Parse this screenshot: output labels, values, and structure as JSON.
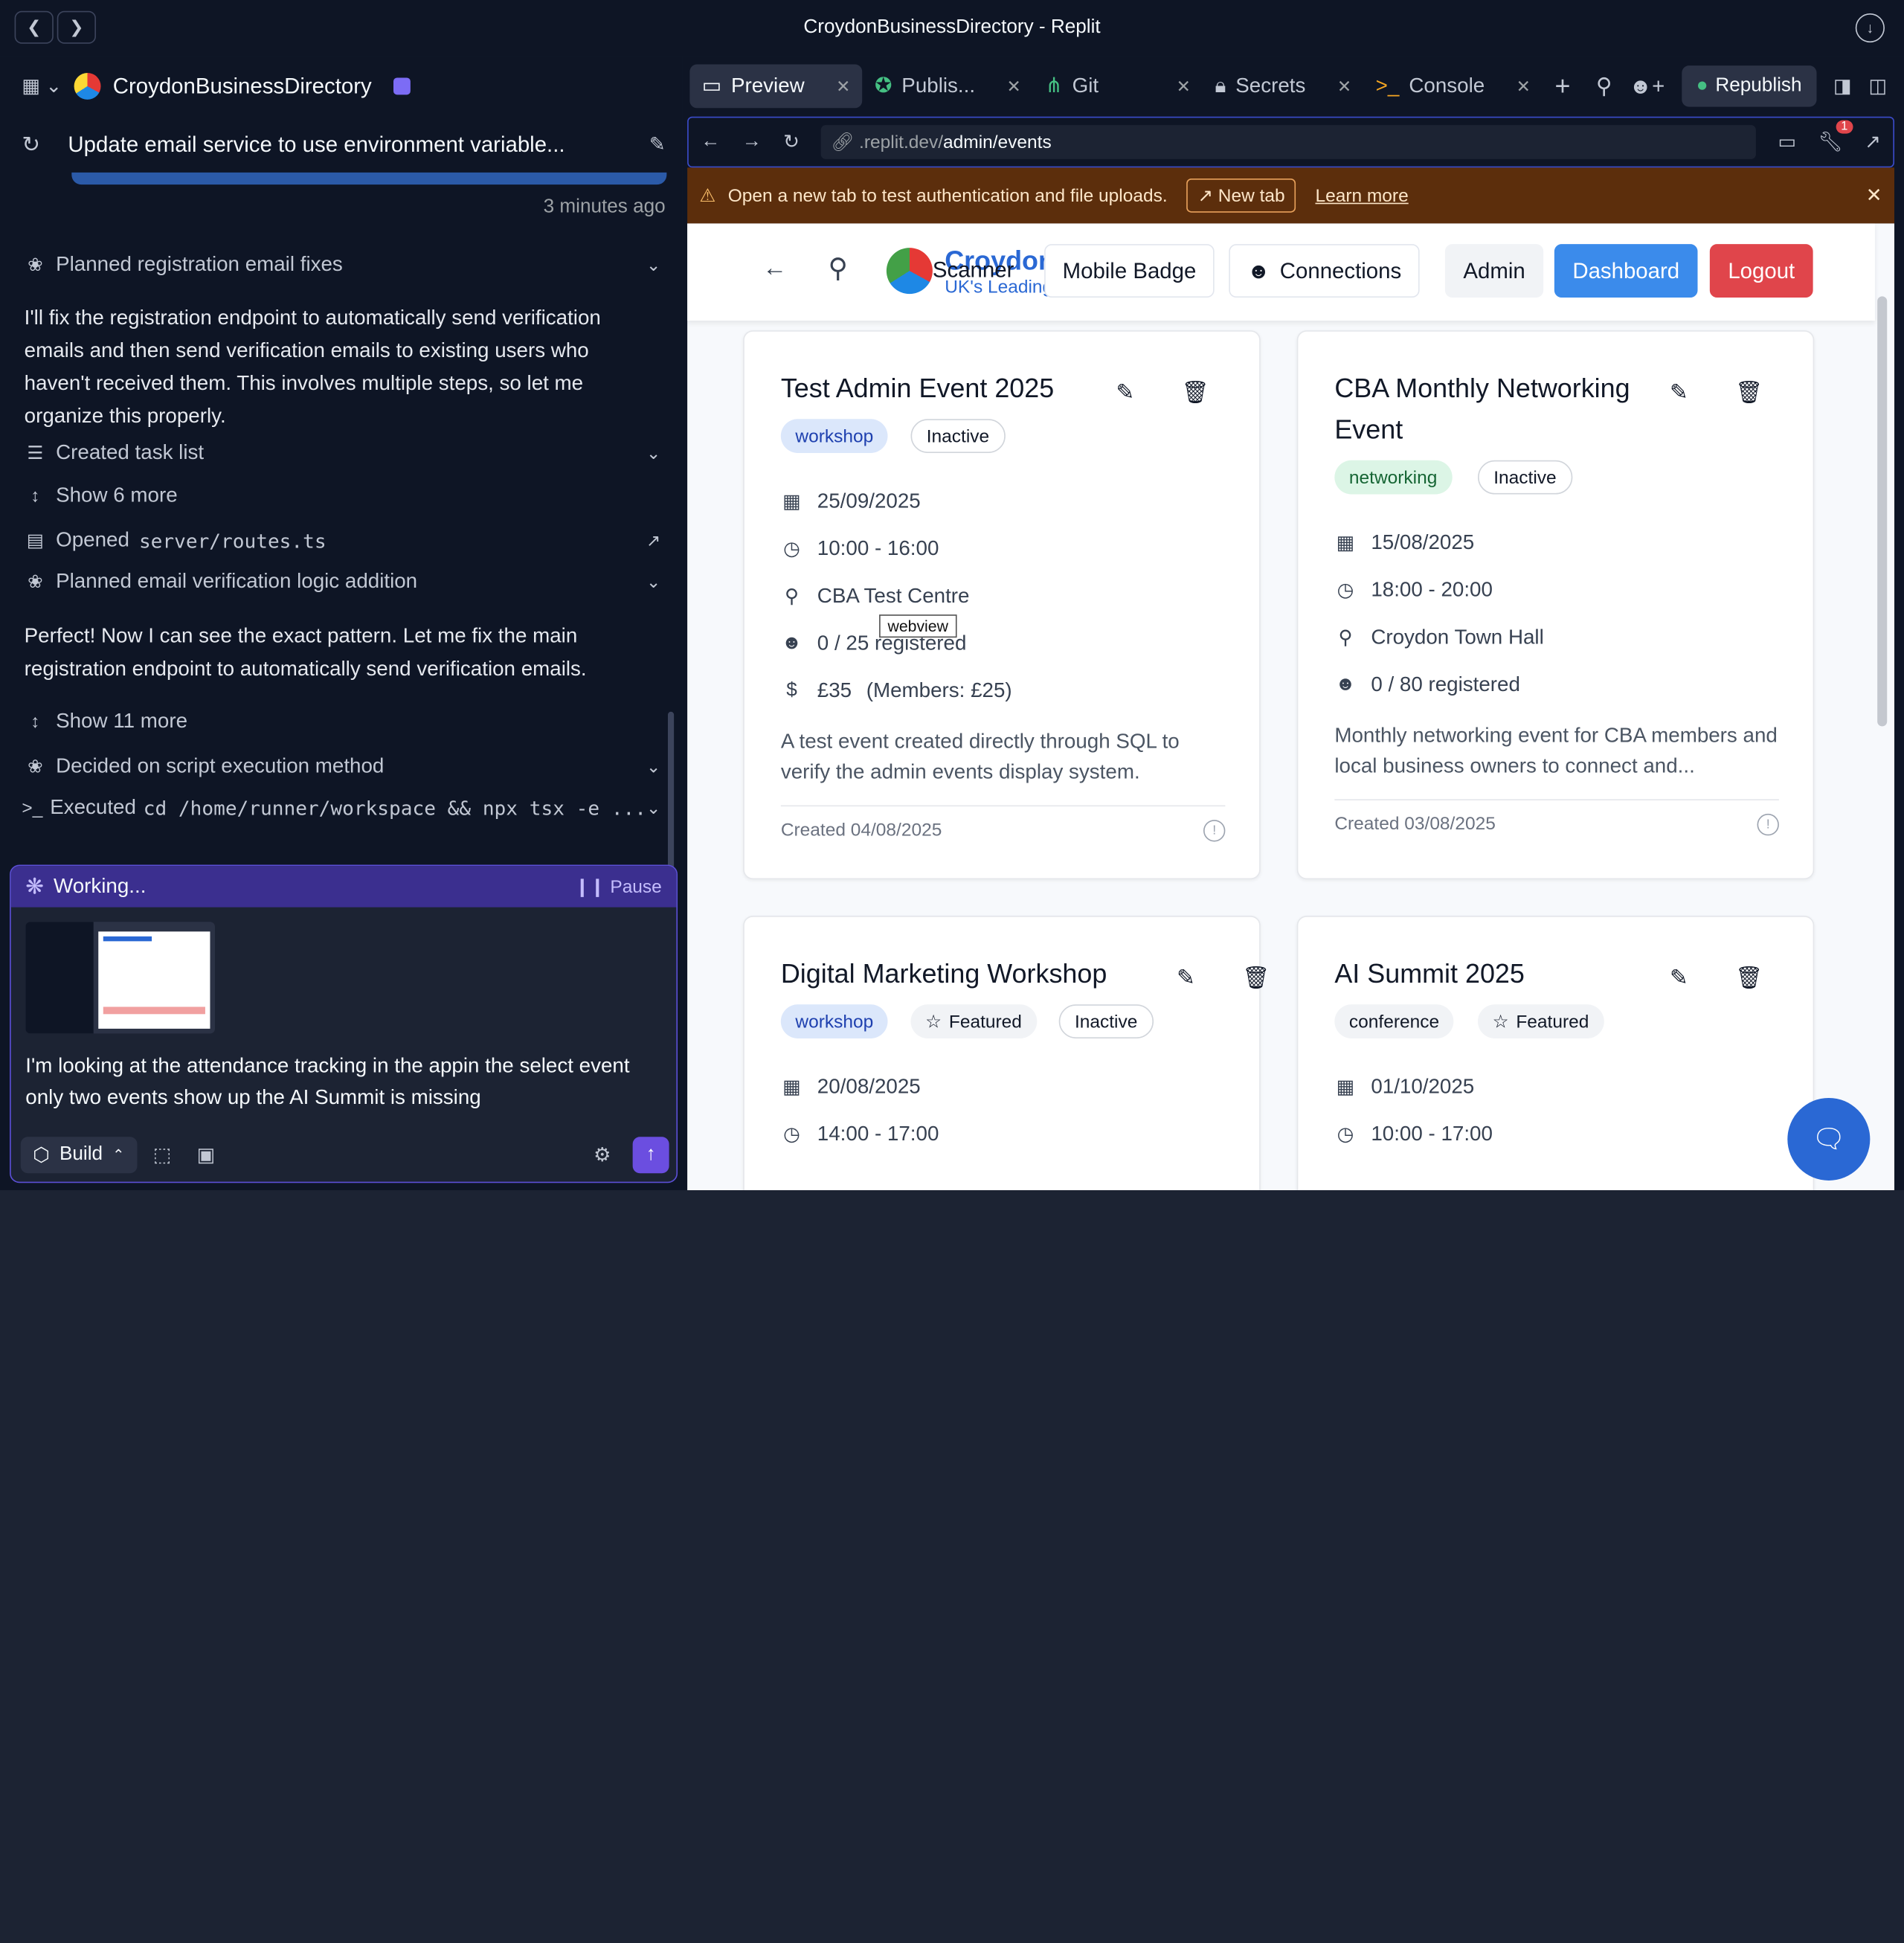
{
  "window": {
    "title": "CroydonBusinessDirectory - Replit"
  },
  "project": {
    "name": "CroydonBusinessDirectory"
  },
  "thread": {
    "title": "Update email service to use environment variable...",
    "time": "3 minutes ago"
  },
  "feed": {
    "step1": "Planned registration email fixes",
    "para1": "I'll fix the registration endpoint to automatically send verification emails and then send verification emails to existing users who haven't received them. This involves multiple steps, so let me organize this properly.",
    "step2": "Created task list",
    "more1": "Show 6 more",
    "opened_prefix": "Opened",
    "opened_file": "server/routes.ts",
    "step3": "Planned email verification logic addition",
    "para2": "Perfect! Now I can see the exact pattern. Let me fix the main registration endpoint to automatically send verification emails.",
    "more2": "Show 11 more",
    "step4": "Decided on script execution method",
    "exec_prefix": "Executed",
    "exec_cmd": "cd /home/runner/workspace && npx tsx -e ..."
  },
  "agent": {
    "status": "Working...",
    "pause": "Pause",
    "prompt": "I'm looking at the attendance tracking in the appin the select event only two events show up the AI Summit is missing",
    "build_label": "Build"
  },
  "tabs": [
    {
      "label": "Preview"
    },
    {
      "label": "Publis..."
    },
    {
      "label": "Git"
    },
    {
      "label": "Secrets"
    },
    {
      "label": "Console"
    }
  ],
  "toolbar": {
    "republish": "Republish",
    "badge_count": "1"
  },
  "url": {
    "prefix": ".replit.dev/",
    "path": "admin/events"
  },
  "warning": {
    "text": "Open a new tab to test authentication and file uploads.",
    "new_tab": "New tab",
    "learn_more": "Learn more"
  },
  "site": {
    "brand": "Croydon",
    "brand_tail": "s",
    "tagline": "UK's Leading",
    "tagline_tail": "es",
    "scanner": "Scanner",
    "mobile_badge": "Mobile Badge",
    "connections": "Connections",
    "admin": "Admin",
    "dashboard": "Dashboard",
    "logout": "Logout"
  },
  "tooltip": "webview",
  "events": [
    {
      "title": "Test Admin Event 2025",
      "category": "workshop",
      "status": "Inactive",
      "date": "25/09/2025",
      "time": "10:00 - 16:00",
      "location": "CBA Test Centre",
      "registered": "0 / 25 registered",
      "price": "£35",
      "members_price": "(Members: £25)",
      "description": "A test event created directly through SQL to verify the admin events display system.",
      "created": "Created 04/08/2025"
    },
    {
      "title": "CBA Monthly Networking Event",
      "category": "networking",
      "status": "Inactive",
      "date": "15/08/2025",
      "time": "18:00 - 20:00",
      "location": "Croydon Town Hall",
      "registered": "0 / 80 registered",
      "description": "Monthly networking event for CBA members and local business owners to connect and...",
      "created": "Created 03/08/2025"
    },
    {
      "title": "Digital Marketing Workshop",
      "category": "workshop",
      "featured": "Featured",
      "status": "Inactive",
      "date": "20/08/2025",
      "time": "14:00 - 17:00"
    },
    {
      "title": "AI Summit 2025",
      "category": "conference",
      "featured": "Featured",
      "date": "01/10/2025",
      "time": "10:00 - 17:00"
    }
  ]
}
